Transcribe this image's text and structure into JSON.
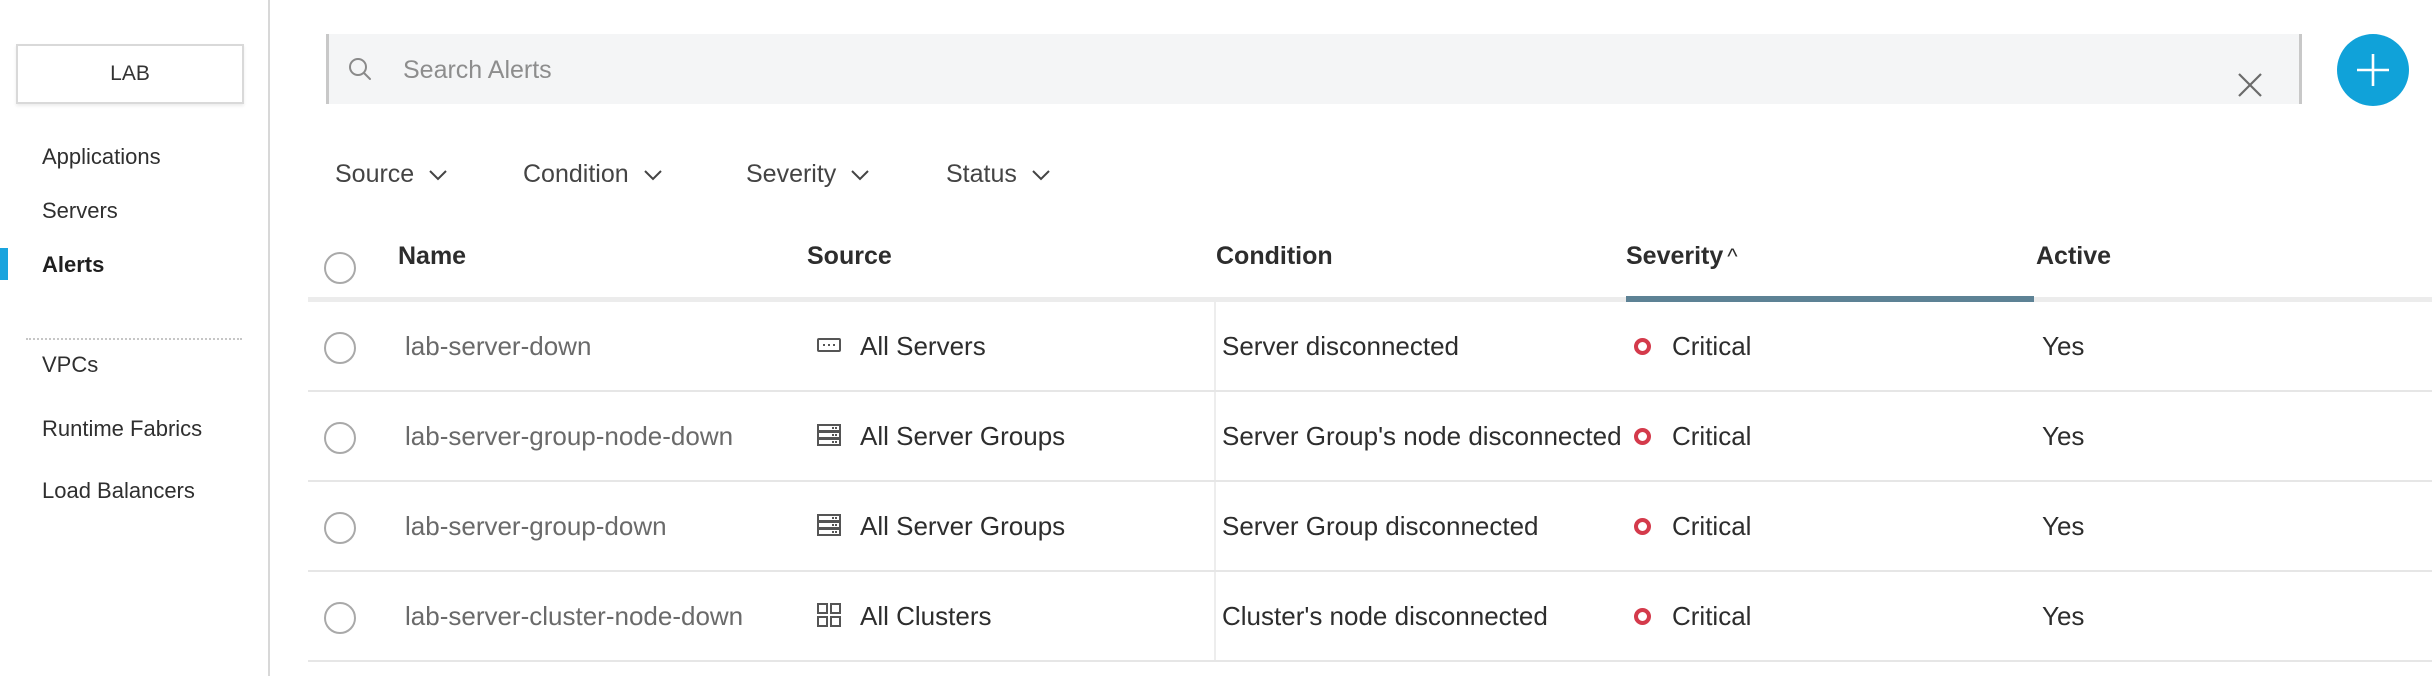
{
  "sidebar": {
    "environment": "LAB",
    "nav_top": [
      {
        "label": "Applications"
      },
      {
        "label": "Servers"
      },
      {
        "label": "Alerts",
        "active": true
      }
    ],
    "nav_bottom": [
      {
        "label": "VPCs"
      },
      {
        "label": "Runtime Fabrics"
      },
      {
        "label": "Load Balancers"
      }
    ],
    "accent_color": "#1aa4de"
  },
  "search": {
    "placeholder": "Search Alerts",
    "value": "",
    "search_icon": "search-icon",
    "clear_icon": "close-icon"
  },
  "add_button": {
    "icon": "plus-icon",
    "color": "#10a2d9"
  },
  "filters": [
    {
      "label": "Source"
    },
    {
      "label": "Condition"
    },
    {
      "label": "Severity"
    },
    {
      "label": "Status"
    }
  ],
  "table": {
    "columns": {
      "name": "Name",
      "source": "Source",
      "condition": "Condition",
      "severity": "Severity",
      "severity_sort_indicator": "^",
      "active": "Active"
    },
    "sorted_by": "Severity",
    "rows": [
      {
        "name": "lab-server-down",
        "source_icon": "server-icon",
        "source": "All Servers",
        "condition": "Server disconnected",
        "severity": "Critical",
        "active": "Yes"
      },
      {
        "name": "lab-server-group-node-down",
        "source_icon": "server-group-icon",
        "source": "All Server Groups",
        "condition": "Server Group's node disconnected",
        "severity": "Critical",
        "active": "Yes"
      },
      {
        "name": "lab-server-group-down",
        "source_icon": "server-group-icon",
        "source": "All Server Groups",
        "condition": "Server Group disconnected",
        "severity": "Critical",
        "active": "Yes"
      },
      {
        "name": "lab-server-cluster-node-down",
        "source_icon": "cluster-icon",
        "source": "All Clusters",
        "condition": "Cluster's node disconnected",
        "severity": "Critical",
        "active": "Yes"
      }
    ],
    "severity_color": "#d43a4b"
  }
}
